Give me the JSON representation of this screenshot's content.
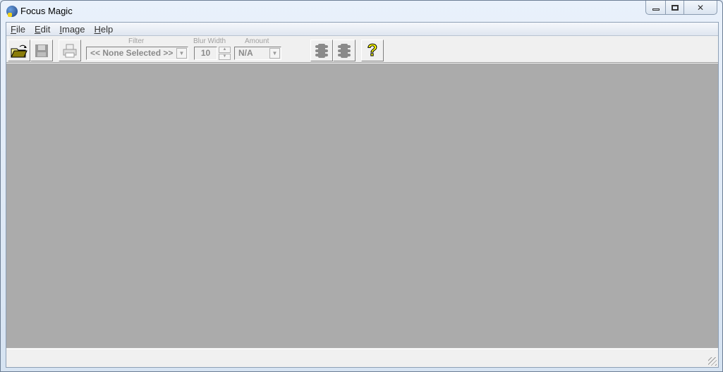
{
  "window": {
    "title": "Focus Magic",
    "minimize": "▭",
    "maximize": "▣",
    "close": "✕"
  },
  "menu": [
    {
      "label": "File",
      "key": "F",
      "rest": "ile"
    },
    {
      "label": "Edit",
      "key": "E",
      "rest": "dit"
    },
    {
      "label": "Image",
      "key": "I",
      "rest": "mage"
    },
    {
      "label": "Help",
      "key": "H",
      "rest": "elp"
    }
  ],
  "toolbar": {
    "filter": {
      "label": "Filter",
      "value": "<< None Selected >>"
    },
    "blur_width": {
      "label": "Blur Width",
      "value": "10"
    },
    "amount": {
      "label": "Amount",
      "value": "N/A"
    },
    "help_glyph": "?"
  },
  "status": {
    "text": ""
  },
  "colors": {
    "canvas": "#ababab",
    "help_icon": "#ffff00"
  }
}
